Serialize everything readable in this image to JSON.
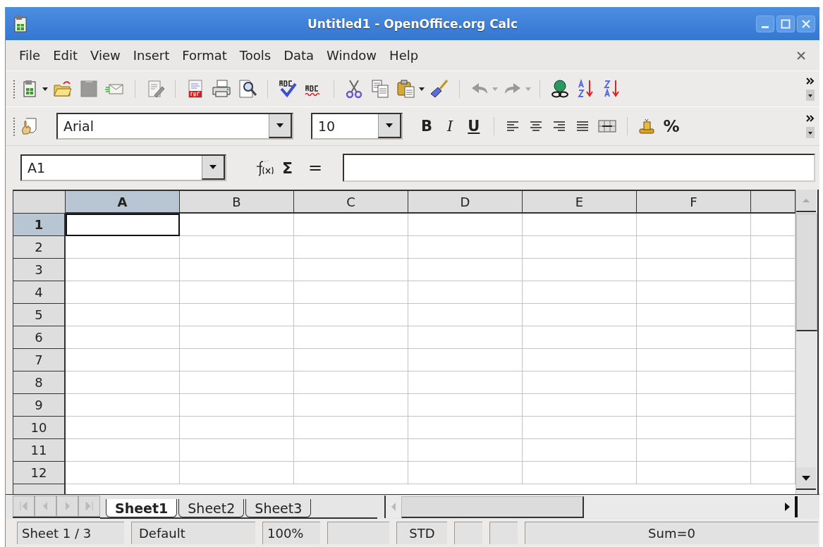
{
  "window": {
    "title": "Untitled1 - OpenOffice.org Calc"
  },
  "menu": [
    {
      "label": "File"
    },
    {
      "label": "Edit"
    },
    {
      "label": "View"
    },
    {
      "label": "Insert"
    },
    {
      "label": "Format"
    },
    {
      "label": "Tools"
    },
    {
      "label": "Data"
    },
    {
      "label": "Window"
    },
    {
      "label": "Help"
    }
  ],
  "formatting": {
    "font": "Arial",
    "size": "10",
    "bold": "B",
    "italic": "I",
    "underline": "U",
    "percent": "%"
  },
  "formula_bar": {
    "cell": "A1",
    "sum": "Σ",
    "equals": "="
  },
  "grid": {
    "columns": [
      {
        "label": "A",
        "selected": true
      },
      {
        "label": "B",
        "selected": false
      },
      {
        "label": "C",
        "selected": false
      },
      {
        "label": "D",
        "selected": false
      },
      {
        "label": "E",
        "selected": false
      },
      {
        "label": "F",
        "selected": false
      }
    ],
    "rows": [
      {
        "label": "1",
        "selected": true
      },
      {
        "label": "2",
        "selected": false
      },
      {
        "label": "3",
        "selected": false
      },
      {
        "label": "4",
        "selected": false
      },
      {
        "label": "5",
        "selected": false
      },
      {
        "label": "6",
        "selected": false
      },
      {
        "label": "7",
        "selected": false
      },
      {
        "label": "8",
        "selected": false
      },
      {
        "label": "9",
        "selected": false
      },
      {
        "label": "10",
        "selected": false
      },
      {
        "label": "11",
        "selected": false
      },
      {
        "label": "12",
        "selected": false
      }
    ]
  },
  "sheet_tabs": [
    {
      "label": "Sheet1",
      "selected": true
    },
    {
      "label": "Sheet2",
      "selected": false
    },
    {
      "label": "Sheet3",
      "selected": false
    }
  ],
  "status_bar": [
    "Sheet 1 / 3",
    "Default",
    "100%",
    "STD",
    "Sum=0"
  ]
}
